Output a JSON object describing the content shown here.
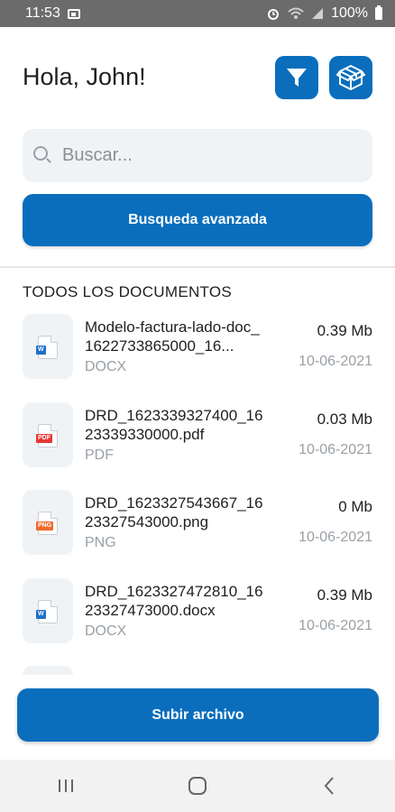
{
  "status_bar": {
    "time": "11:53",
    "battery": "100%"
  },
  "header": {
    "greeting": "Hola, John!"
  },
  "search": {
    "placeholder": "Buscar..."
  },
  "advanced_search_label": "Busqueda avanzada",
  "section_title": "TODOS LOS DOCUMENTOS",
  "documents": [
    {
      "name": "Modelo-factura-lado-doc_1622733865000_16...",
      "ext": "DOCX",
      "size": "0.39 Mb",
      "date": "10-06-2021",
      "icon": "word-file-icon",
      "badge": "W",
      "badge_color": "#1e6fc9"
    },
    {
      "name": "DRD_1623339327400_1623339330000.pdf",
      "ext": "PDF",
      "size": "0.03 Mb",
      "date": "10-06-2021",
      "icon": "pdf-file-icon",
      "badge": "PDF",
      "badge_color": "#e53935"
    },
    {
      "name": "DRD_1623327543667_1623327543000.png",
      "ext": "PNG",
      "size": "0 Mb",
      "date": "10-06-2021",
      "icon": "png-file-icon",
      "badge": "PNG",
      "badge_color": "#f06a2b"
    },
    {
      "name": "DRD_1623327472810_1623327473000.docx",
      "ext": "DOCX",
      "size": "0.39 Mb",
      "date": "10-06-2021",
      "icon": "word-file-icon",
      "badge": "W",
      "badge_color": "#1e6fc9"
    }
  ],
  "upload_label": "Subir archivo",
  "colors": {
    "primary": "#0a6ebd",
    "thumb_bg": "#f0f3f6"
  },
  "nav": [
    "recent-apps-icon",
    "home-icon",
    "back-icon"
  ]
}
